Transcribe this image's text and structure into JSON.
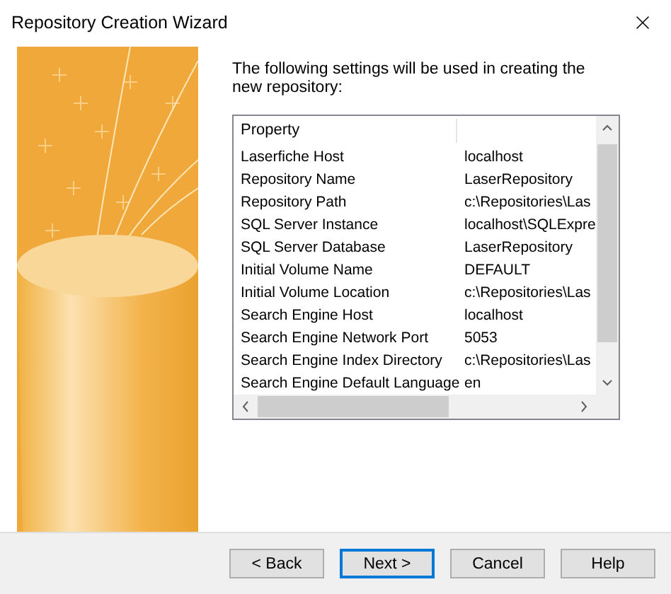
{
  "window": {
    "title": "Repository Creation Wizard"
  },
  "intro": "The following settings will be used in creating the new repository:",
  "table": {
    "columns": [
      "Property"
    ],
    "rows": [
      {
        "property": "Laserfiche Host",
        "value": "localhost"
      },
      {
        "property": "Repository Name",
        "value": "LaserRepository"
      },
      {
        "property": "Repository Path",
        "value": "c:\\Repositories\\Las"
      },
      {
        "property": "SQL Server Instance",
        "value": "localhost\\SQLExpre"
      },
      {
        "property": "SQL Server Database",
        "value": "LaserRepository"
      },
      {
        "property": "Initial Volume Name",
        "value": "DEFAULT"
      },
      {
        "property": "Initial Volume Location",
        "value": "c:\\Repositories\\Las"
      },
      {
        "property": "Search Engine Host",
        "value": "localhost"
      },
      {
        "property": "Search Engine Network Port",
        "value": "5053"
      },
      {
        "property": "Search Engine Index Directory",
        "value": "c:\\Repositories\\Las"
      },
      {
        "property": "Search Engine Default Language",
        "value": "en"
      }
    ]
  },
  "buttons": [
    {
      "label": "< Back",
      "focused": false
    },
    {
      "label": "Next >",
      "focused": true
    },
    {
      "label": "Cancel",
      "focused": false
    },
    {
      "label": "Help",
      "focused": false
    }
  ]
}
